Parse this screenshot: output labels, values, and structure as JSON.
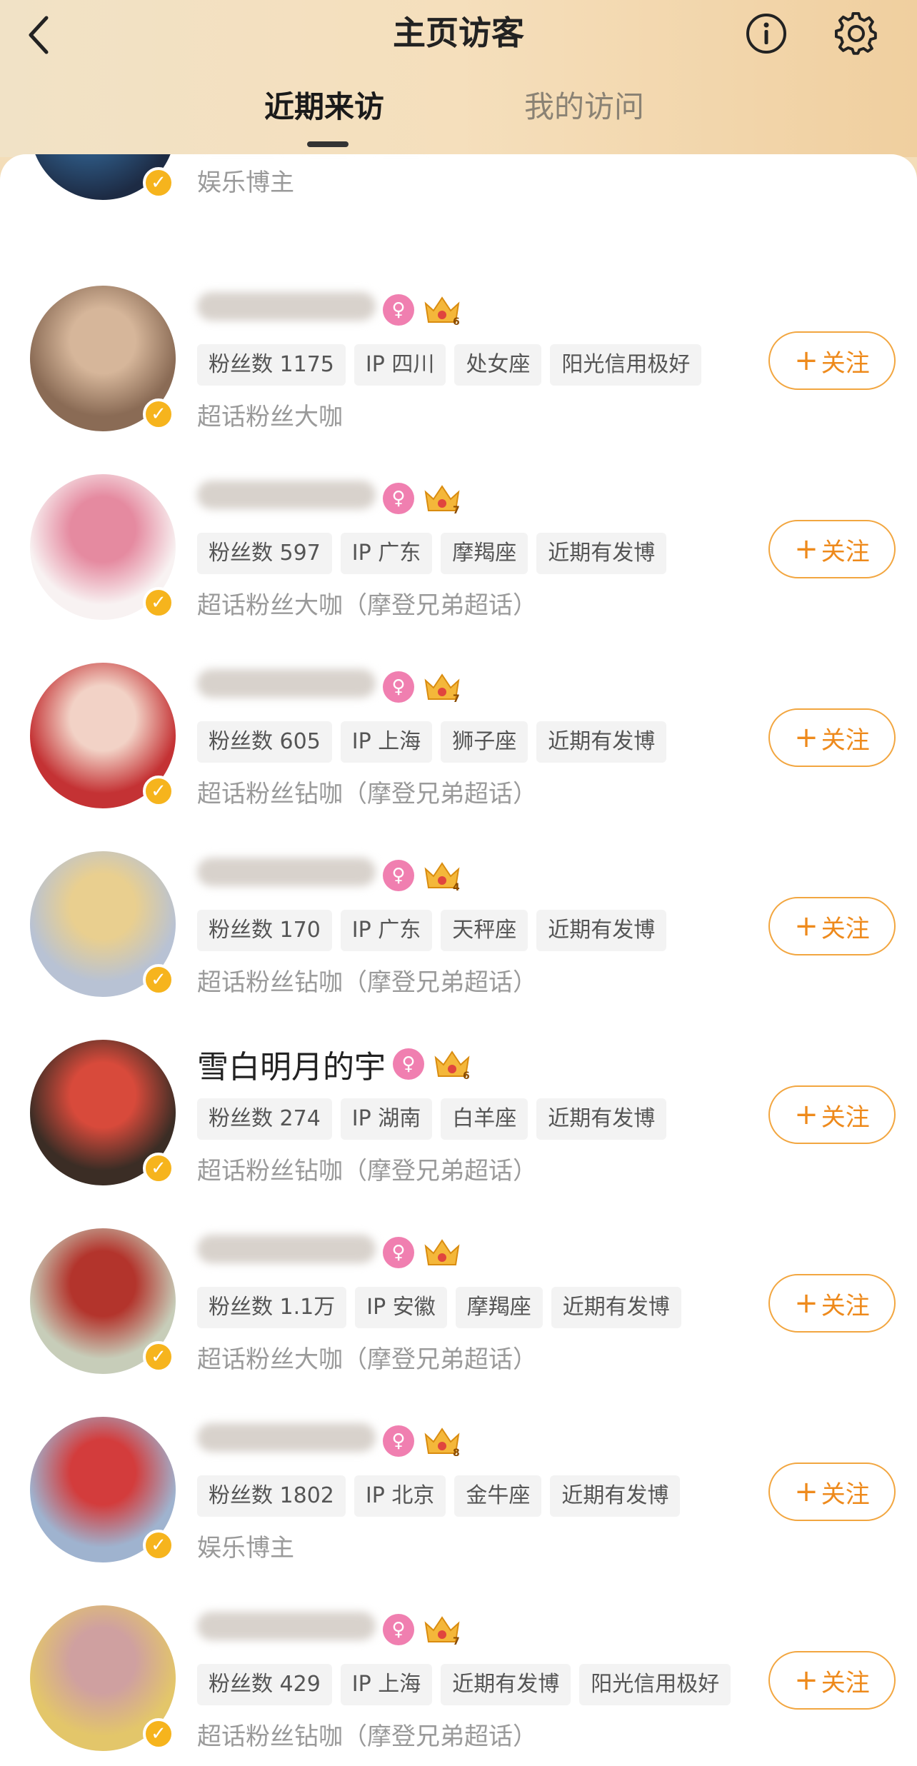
{
  "header": {
    "title": "主页访客",
    "back_icon": "chevron-left-icon",
    "info_icon": "info-icon",
    "settings_icon": "gear-icon"
  },
  "tabs": [
    {
      "label": "近期来访",
      "active": true
    },
    {
      "label": "我的访问",
      "active": false
    }
  ],
  "colors": {
    "accent": "#ee8a1c",
    "follow_border": "#f2a640",
    "verify_badge": "#f6b41d",
    "gender_pink": "#f07fb0",
    "tag_bg": "#f3f3f3",
    "muted_text": "#9a9a9a"
  },
  "follow_label": "关注",
  "partial_top_row": {
    "desc": "娱乐博主"
  },
  "visitors": [
    {
      "name": "",
      "tags": [
        "粉丝数 1175",
        "IP 四川",
        "处女座",
        "阳光信用极好"
      ],
      "desc": "超话粉丝大咖",
      "crown_level": "6",
      "avatar_color": [
        "#8a6b55",
        "#d6b69a"
      ]
    },
    {
      "name": "",
      "tags": [
        "粉丝数 597",
        "IP 广东",
        "摩羯座",
        "近期有发博"
      ],
      "desc": "超话粉丝大咖（摩登兄弟超话）",
      "crown_level": "7",
      "avatar_color": [
        "#f8f2f2",
        "#e58aa0"
      ]
    },
    {
      "name": "",
      "tags": [
        "粉丝数 605",
        "IP 上海",
        "狮子座",
        "近期有发博"
      ],
      "desc": "超话粉丝钻咖（摩登兄弟超话）",
      "crown_level": "7",
      "avatar_color": [
        "#c43234",
        "#f2d2c6"
      ]
    },
    {
      "name": "",
      "tags": [
        "粉丝数 170",
        "IP 广东",
        "天秤座",
        "近期有发博"
      ],
      "desc": "超话粉丝钻咖（摩登兄弟超话）",
      "crown_level": "4",
      "avatar_color": [
        "#b8c2d4",
        "#e9cf8f"
      ]
    },
    {
      "name": "雪白明月的宇",
      "tags": [
        "粉丝数 274",
        "IP 湖南",
        "白羊座",
        "近期有发博"
      ],
      "desc": "超话粉丝钻咖（摩登兄弟超话）",
      "crown_level": "6",
      "avatar_color": [
        "#3b2d25",
        "#d84a3b"
      ]
    },
    {
      "name": "",
      "tags": [
        "粉丝数 1.1万",
        "IP 安徽",
        "摩羯座",
        "近期有发博"
      ],
      "desc": "超话粉丝大咖（摩登兄弟超话）",
      "crown_level": "",
      "avatar_color": [
        "#c7cdb9",
        "#b3342c"
      ]
    },
    {
      "name": "",
      "tags": [
        "粉丝数 1802",
        "IP 北京",
        "金牛座",
        "近期有发博"
      ],
      "desc": "娱乐博主",
      "crown_level": "8",
      "avatar_color": [
        "#9fb3cf",
        "#d33c3c"
      ]
    },
    {
      "name": "",
      "tags": [
        "粉丝数 429",
        "IP 上海",
        "近期有发博",
        "阳光信用极好"
      ],
      "desc": "超话粉丝钻咖（摩登兄弟超话）",
      "crown_level": "7",
      "avatar_color": [
        "#e3c66a",
        "#cfa0a0"
      ]
    }
  ]
}
